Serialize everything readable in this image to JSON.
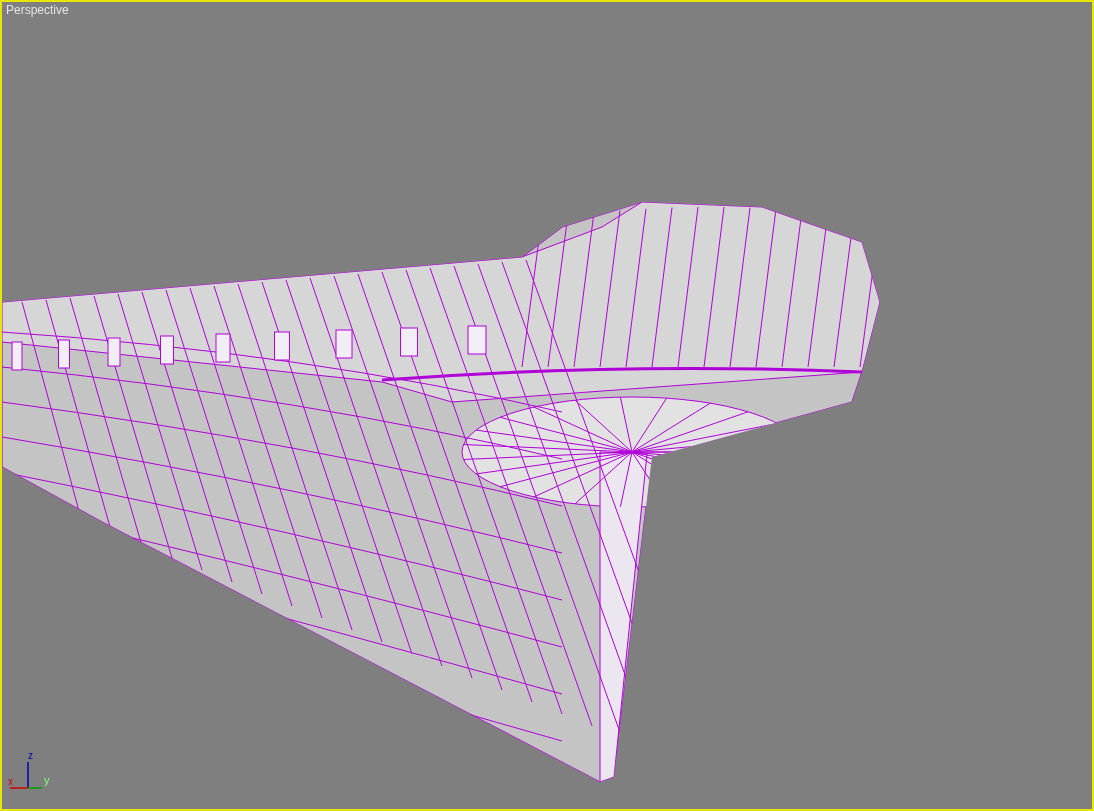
{
  "viewport": {
    "label": "Perspective",
    "active": true
  },
  "axis_gizmo": {
    "x": "x",
    "y": "y",
    "z": "z"
  }
}
